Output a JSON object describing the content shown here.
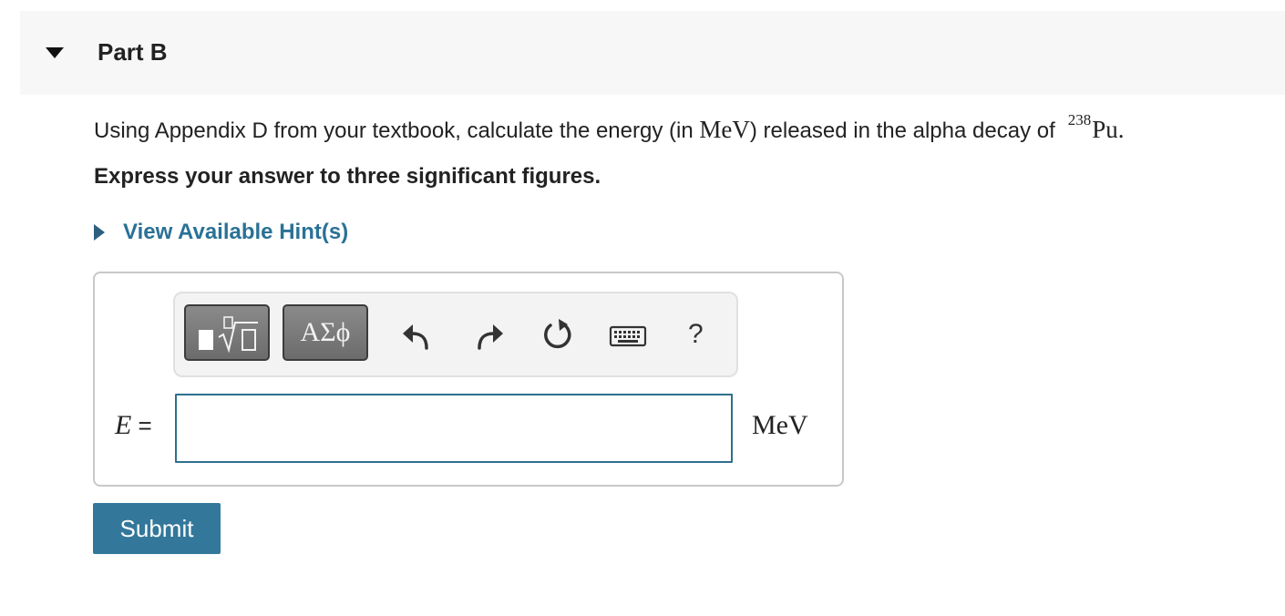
{
  "part": {
    "title": "Part B"
  },
  "question": {
    "text_before": "Using Appendix D from your textbook, calculate the energy (in ",
    "unit": "MeV",
    "text_after": ") released in the alpha decay of",
    "isotope_mass": "238",
    "isotope_symbol": "Pu",
    "end_period": "."
  },
  "instruction": "Express your answer to three significant figures.",
  "hint": {
    "label": "View Available Hint(s)"
  },
  "toolbar": {
    "symbols_label": "ΑΣϕ",
    "help_label": "?",
    "icons": [
      "templates-icon",
      "undo-icon",
      "redo-icon",
      "reset-icon",
      "keyboard-icon",
      "help-icon"
    ]
  },
  "answer": {
    "variable": "E",
    "equals": " =",
    "value": "",
    "placeholder": "",
    "unit": "MeV"
  },
  "submit_label": "Submit",
  "colors": {
    "link": "#2a7196",
    "submit_bg": "#33789a",
    "input_border": "#2f6f8c",
    "header_bg": "#f7f7f7"
  }
}
